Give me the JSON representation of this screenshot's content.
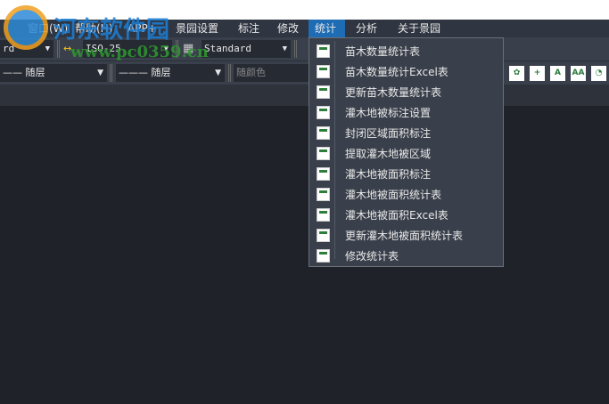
{
  "menubar": {
    "items": [
      "窗口(W)",
      "帮助(H)",
      "APP+",
      "景园设置",
      "标注",
      "修改",
      "统计",
      "分析",
      "关于景园"
    ],
    "active": "统计"
  },
  "toolbar1": {
    "combo_left": "rd",
    "dim_style": "ISO-25",
    "table_style": "Standard"
  },
  "toolbar2": {
    "linetype": "—— 随层",
    "lineweight": "——— 随层",
    "color": "随颜色"
  },
  "dropdown": {
    "items": [
      "苗木数量统计表",
      "苗木数量统计Excel表",
      "更新苗木数量统计表",
      "灌木地被标注设置",
      "封闭区域面积标注",
      "提取灌木地被区域",
      "灌木地被面积标注",
      "灌木地被面积统计表",
      "灌木地被面积Excel表",
      "更新灌木地被面积统计表",
      "修改统计表"
    ]
  },
  "watermark": {
    "name": "河东软件园",
    "url": "www.pc0359.cn"
  }
}
